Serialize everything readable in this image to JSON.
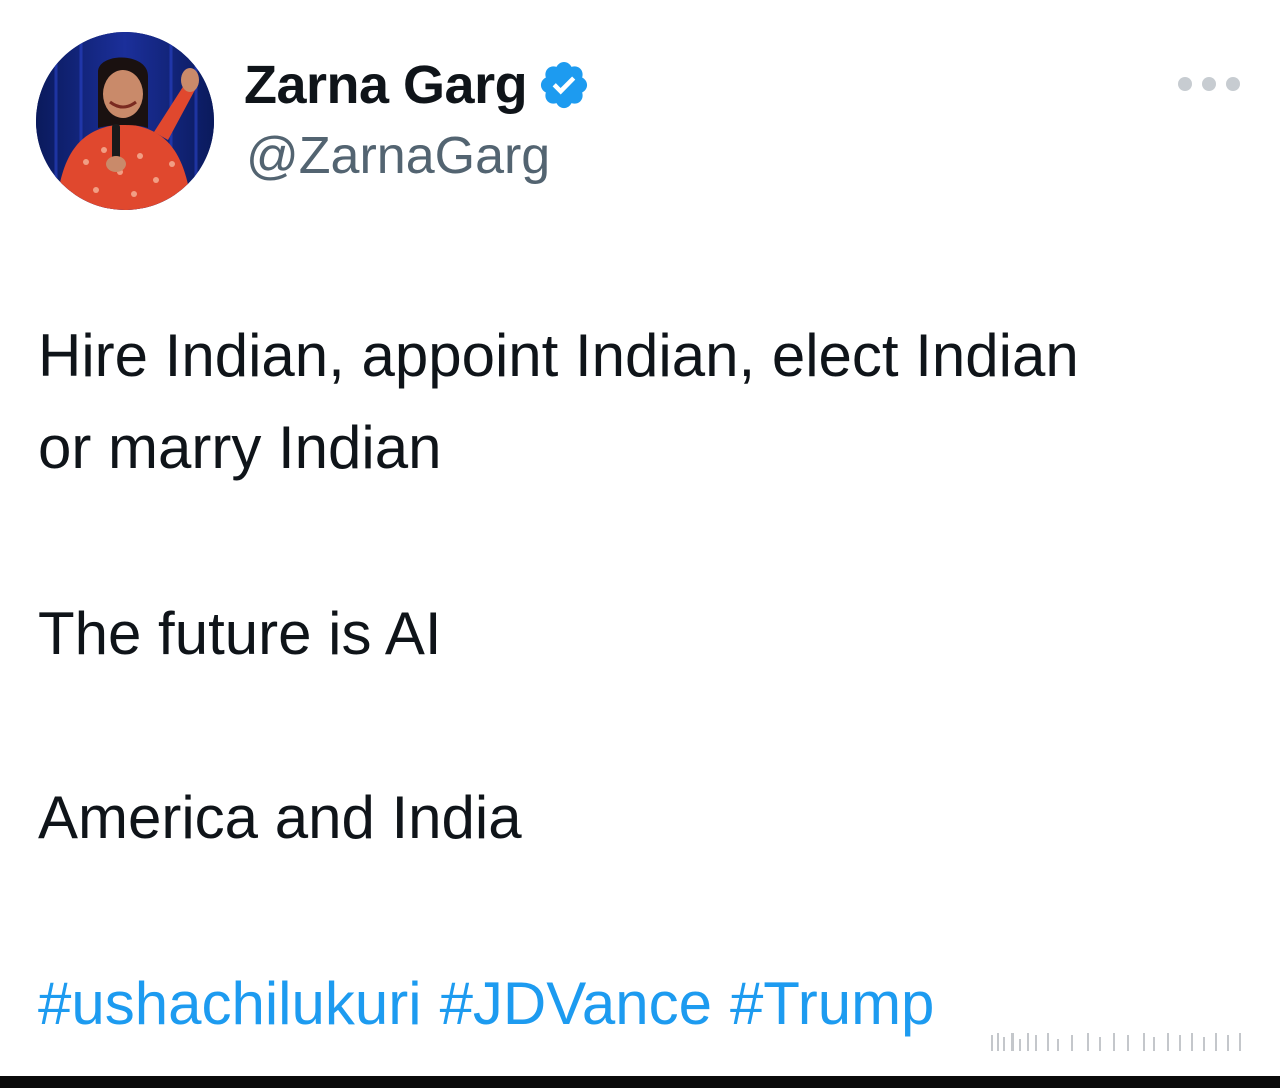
{
  "tweet": {
    "display_name": "Zarna Garg",
    "handle": "@ZarnaGarg",
    "verified": true,
    "body_lines": [
      "Hire Indian, appoint Indian, elect Indian",
      "or marry Indian",
      "The future is AI",
      "America and India"
    ],
    "hashtags": [
      "#ushachilukuri",
      "#JDVance",
      "#Trump"
    ],
    "more_icon": "ellipsis-icon"
  },
  "colors": {
    "text": "#0f1419",
    "secondary_text": "#536471",
    "link": "#1d9bf0",
    "verified_badge": "#1d9bf0",
    "background": "#ffffff"
  }
}
